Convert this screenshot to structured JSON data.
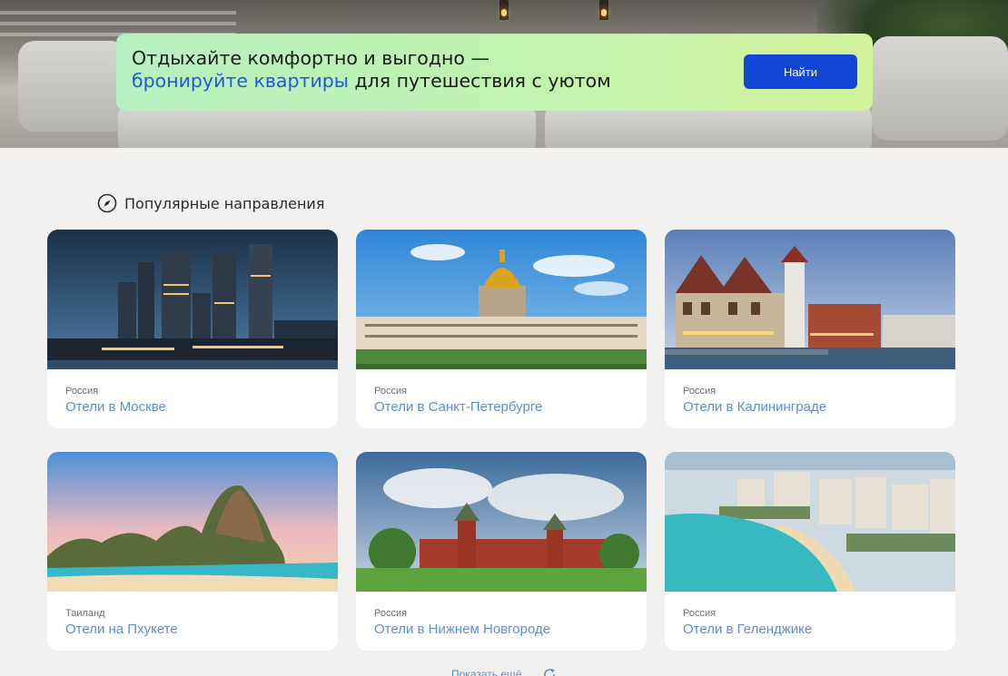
{
  "banner": {
    "line1": "Отдыхайте комфортно и выгодно —",
    "line2_accent": "бронируйте квартиры",
    "line2_rest": " для путешествия с уютом",
    "button_label": "Найти"
  },
  "section": {
    "title": "Популярные направления",
    "icon": "compass-icon"
  },
  "cards": [
    {
      "country": "Россия",
      "city": "Отели в Москве"
    },
    {
      "country": "Россия",
      "city": "Отели в Санкт-Петербурге"
    },
    {
      "country": "Россия",
      "city": "Отели в Калининграде"
    },
    {
      "country": "Таиланд",
      "city": "Отели на Пхукете"
    },
    {
      "country": "Россия",
      "city": "Отели в Нижнем Новгороде"
    },
    {
      "country": "Россия",
      "city": "Отели в Геленджике"
    }
  ],
  "show_more": {
    "label": "Показать ещё",
    "icon": "refresh-icon"
  },
  "colors": {
    "accent_blue": "#1e5bd6",
    "button_blue": "#1345d4",
    "link_blue": "#5c8fd0",
    "banner_green": "#c2f3b0",
    "page_bg": "#f2f1ef"
  }
}
